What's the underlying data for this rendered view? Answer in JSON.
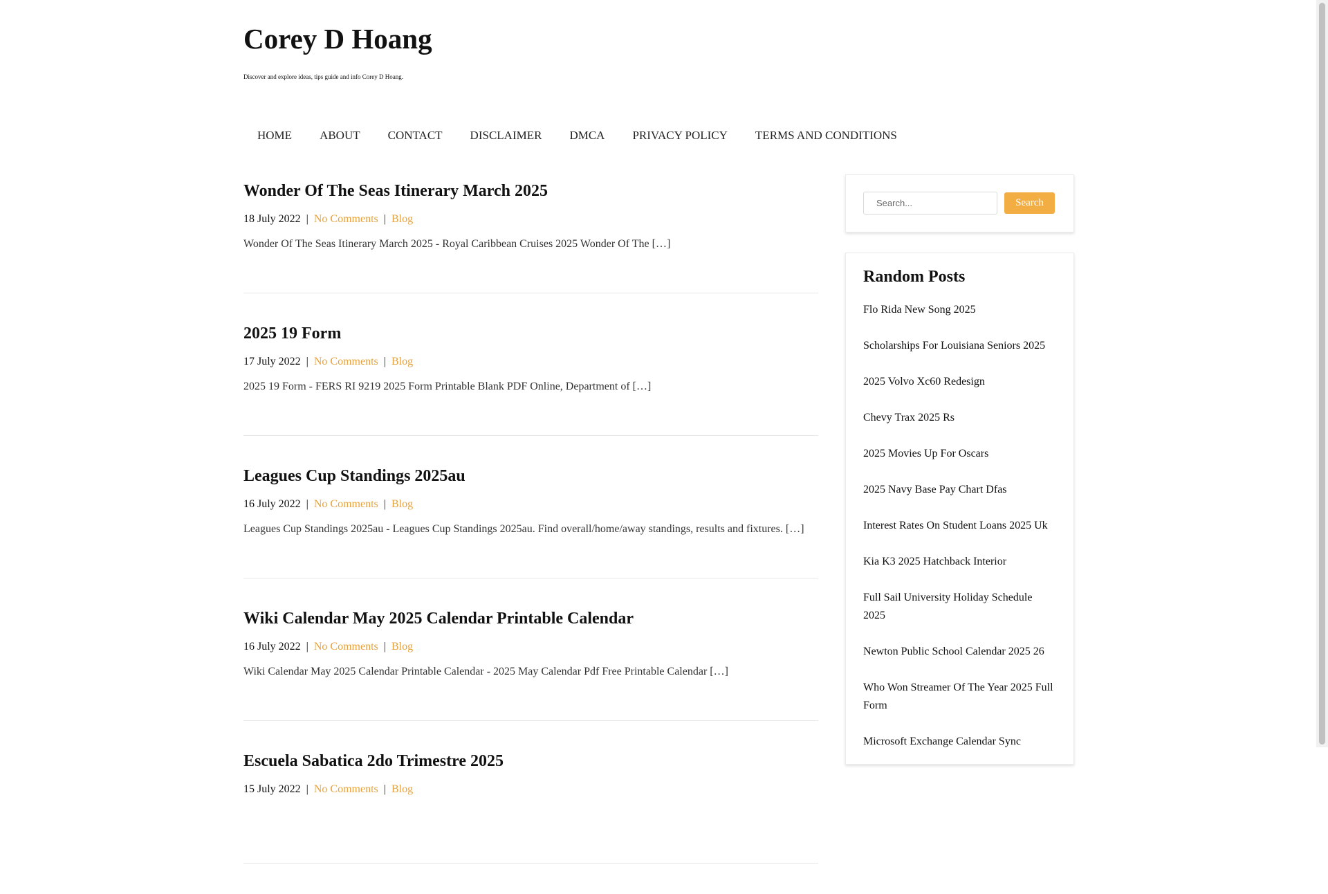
{
  "site": {
    "title": "Corey D Hoang",
    "tagline": "Discover and explore ideas, tips guide and info Corey D Hoang."
  },
  "nav": {
    "items": [
      "HOME",
      "ABOUT",
      "CONTACT",
      "DISCLAIMER",
      "DMCA",
      "PRIVACY POLICY",
      "TERMS AND CONDITIONS"
    ]
  },
  "posts": [
    {
      "title": "Wonder Of The Seas Itinerary March 2025",
      "date": "18 July 2022",
      "comments": "No Comments",
      "category": "Blog",
      "excerpt": "Wonder Of The Seas Itinerary March 2025 - Royal Caribbean Cruises 2025 Wonder Of The […]"
    },
    {
      "title": "2025 19 Form",
      "date": "17 July 2022",
      "comments": "No Comments",
      "category": "Blog",
      "excerpt": "2025 19 Form - FERS RI 9219 2025 Form Printable Blank PDF Online, Department of […]"
    },
    {
      "title": "Leagues Cup Standings 2025au",
      "date": "16 July 2022",
      "comments": "No Comments",
      "category": "Blog",
      "excerpt": "Leagues Cup Standings 2025au - Leagues Cup Standings 2025au. Find overall/home/away standings, results and fixtures. […]"
    },
    {
      "title": "Wiki Calendar May 2025 Calendar Printable Calendar",
      "date": "16 July 2022",
      "comments": "No Comments",
      "category": "Blog",
      "excerpt": "Wiki Calendar May 2025 Calendar Printable Calendar - 2025 May Calendar Pdf Free Printable Calendar […]"
    },
    {
      "title": "Escuela Sabatica 2do Trimestre 2025",
      "date": "15 July 2022",
      "comments": "No Comments",
      "category": "Blog",
      "excerpt": ""
    }
  ],
  "search": {
    "placeholder": "Search...",
    "button_label": "Search"
  },
  "random_posts": {
    "title": "Random Posts",
    "items": [
      "Flo Rida New Song 2025",
      "Scholarships For Louisiana Seniors 2025",
      "2025 Volvo Xc60 Redesign",
      "Chevy Trax 2025 Rs",
      "2025 Movies Up For Oscars",
      "2025 Navy Base Pay Chart Dfas",
      "Interest Rates On Student Loans 2025 Uk",
      "Kia K3 2025 Hatchback Interior",
      "Full Sail University Holiday Schedule 2025",
      "Newton Public School Calendar 2025 26",
      "Who Won Streamer Of The Year 2025 Full Form",
      "Microsoft Exchange Calendar Sync"
    ]
  },
  "colors": {
    "accent": "#f2ae43",
    "link_meta": "#e6a23c",
    "text": "#111111"
  }
}
